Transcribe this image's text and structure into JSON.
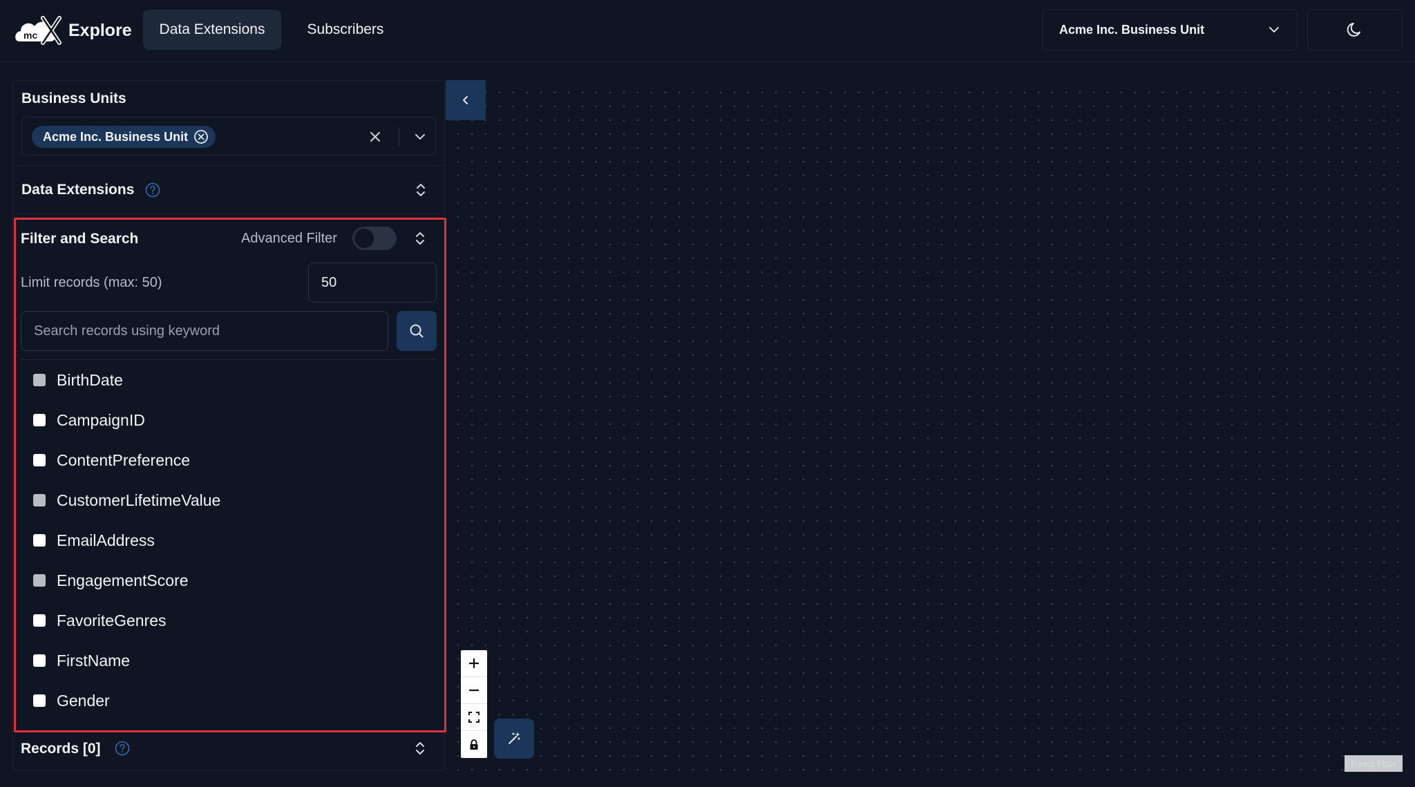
{
  "app": {
    "logo_text": "mc",
    "title": "Explore"
  },
  "nav": {
    "tabs": [
      {
        "label": "Data Extensions",
        "active": true
      },
      {
        "label": "Subscribers",
        "active": false
      }
    ]
  },
  "header": {
    "business_unit_selected": "Acme Inc. Business Unit",
    "theme_icon": "moon-icon"
  },
  "sidebar": {
    "business_units": {
      "title": "Business Units",
      "chip_label": "Acme Inc. Business Unit"
    },
    "data_extensions": {
      "title": "Data Extensions"
    },
    "filter": {
      "title": "Filter and Search",
      "advanced_filter_label": "Advanced Filter",
      "advanced_filter_on": false,
      "limit_label": "Limit records (max: 50)",
      "limit_value": "50",
      "search_placeholder": "Search records using keyword",
      "fields": [
        {
          "label": "BirthDate",
          "checked": false,
          "dim": true
        },
        {
          "label": "CampaignID",
          "checked": false,
          "dim": false
        },
        {
          "label": "ContentPreference",
          "checked": false,
          "dim": false
        },
        {
          "label": "CustomerLifetimeValue",
          "checked": false,
          "dim": true
        },
        {
          "label": "EmailAddress",
          "checked": false,
          "dim": false
        },
        {
          "label": "EngagementScore",
          "checked": false,
          "dim": true
        },
        {
          "label": "FavoriteGenres",
          "checked": false,
          "dim": false
        },
        {
          "label": "FirstName",
          "checked": false,
          "dim": false
        },
        {
          "label": "Gender",
          "checked": false,
          "dim": false
        }
      ]
    },
    "records": {
      "title": "Records [0]"
    }
  },
  "canvas": {
    "attribution": "React Flow"
  },
  "colors": {
    "background": "#0f1522",
    "accent": "#1b3658",
    "highlight_border": "#e0313d",
    "help_icon": "#2f6db5"
  }
}
